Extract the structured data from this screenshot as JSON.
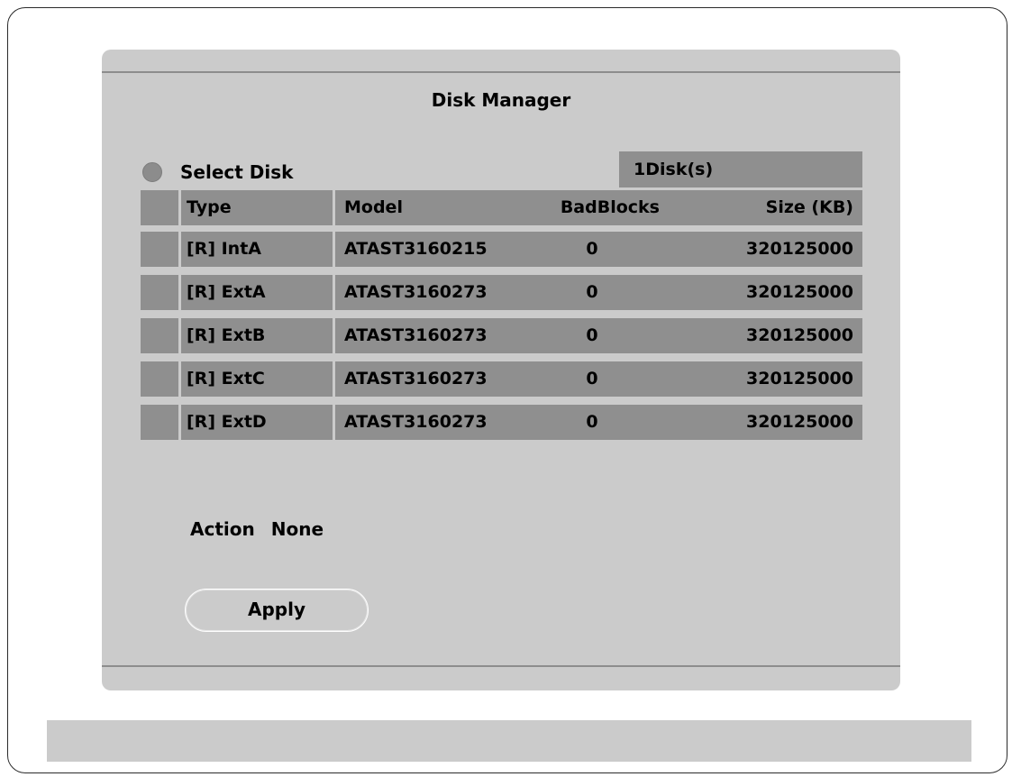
{
  "dialog": {
    "title": "Disk Manager",
    "select_label": "Select Disk",
    "disk_count": "1Disk(s)"
  },
  "table": {
    "headers": {
      "type": "Type",
      "model": "Model",
      "badblocks": "BadBlocks",
      "size": "Size (KB)"
    },
    "rows": [
      {
        "type": "[R] IntA",
        "model": "ATAST3160215",
        "badblocks": "0",
        "size": "320125000"
      },
      {
        "type": "[R] ExtA",
        "model": "ATAST3160273",
        "badblocks": "0",
        "size": "320125000"
      },
      {
        "type": "[R] ExtB",
        "model": "ATAST3160273",
        "badblocks": "0",
        "size": "320125000"
      },
      {
        "type": "[R] ExtC",
        "model": "ATAST3160273",
        "badblocks": "0",
        "size": "320125000"
      },
      {
        "type": "[R] ExtD",
        "model": "ATAST3160273",
        "badblocks": "0",
        "size": "320125000"
      }
    ]
  },
  "action": {
    "label": "Action",
    "value": "None"
  },
  "apply_label": "Apply",
  "colors": {
    "panel": "#cbcbcb",
    "cell": "#8f8f8f",
    "rule": "#8d8d8d",
    "radio": "#8c8c8c"
  },
  "icons": {
    "radio": "radio-dot-icon"
  }
}
